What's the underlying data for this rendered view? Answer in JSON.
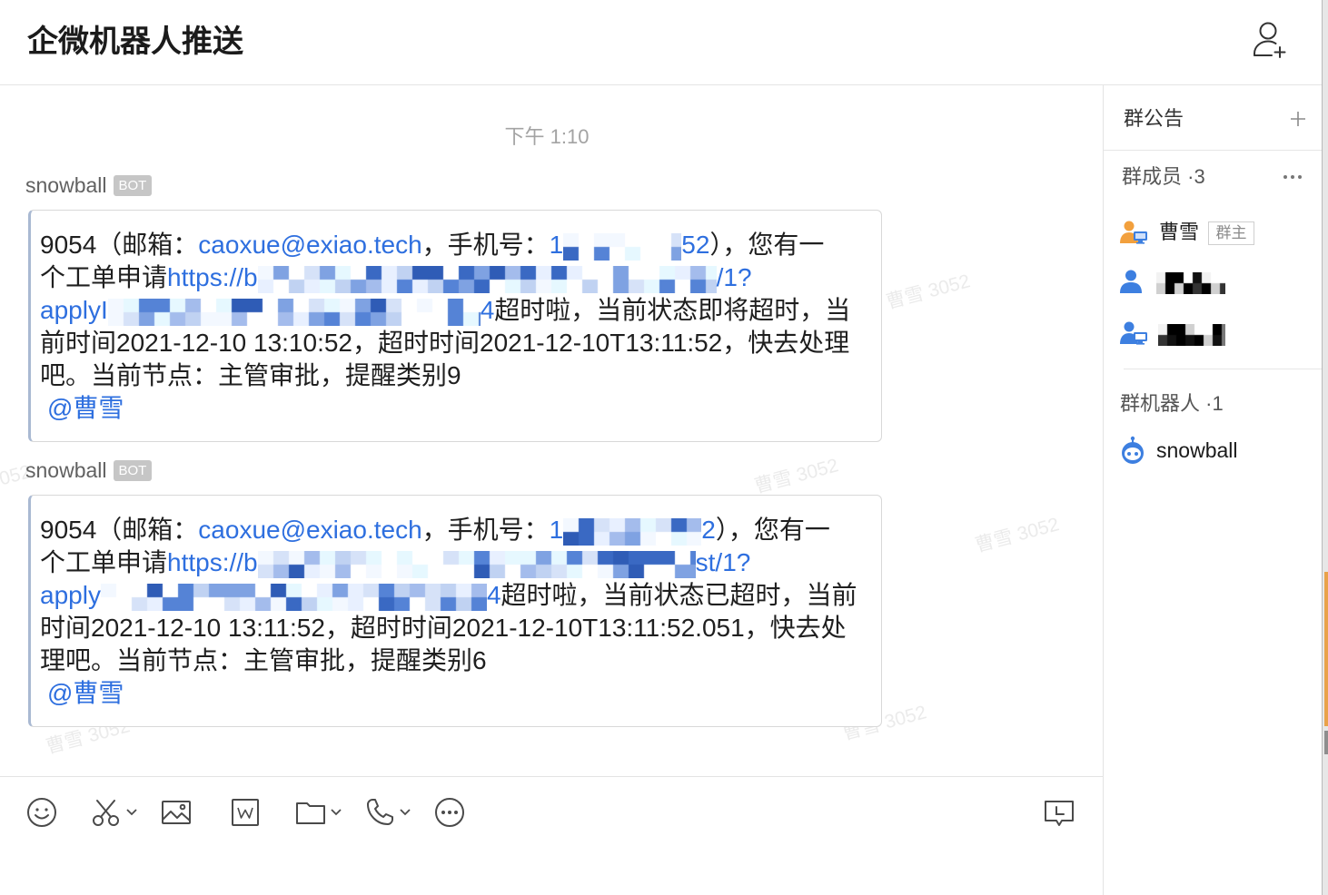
{
  "window": {
    "title": "企微机器人推送",
    "add_member_icon": "add-person-icon"
  },
  "chat": {
    "timestamp": "下午 1:10",
    "watermark": "曹雪 3052",
    "messages": [
      {
        "sender": "snowball",
        "badge": "BOT",
        "lines": [
          [
            {
              "t": "text",
              "v": "9054（邮箱："
            },
            {
              "t": "link",
              "v": "caoxue@exiao.tech"
            },
            {
              "t": "text",
              "v": "，手机号："
            },
            {
              "t": "link",
              "v": "1"
            },
            {
              "t": "redacted"
            },
            {
              "t": "link",
              "v": "52"
            },
            {
              "t": "text",
              "v": "），您有一"
            }
          ],
          [
            {
              "t": "text",
              "v": "个工单申请"
            },
            {
              "t": "link",
              "v": "https://b"
            },
            {
              "t": "redacted"
            },
            {
              "t": "link",
              "v": "/1?"
            }
          ],
          [
            {
              "t": "link",
              "v": "applyI"
            },
            {
              "t": "redacted"
            },
            {
              "t": "link",
              "v": "4"
            },
            {
              "t": "text",
              "v": "超时啦，当前状态即将超时，当"
            }
          ],
          [
            {
              "t": "text",
              "v": "前时间2021-12-10 13:10:52，超时时间2021-12-10T13:11:52，快去处理"
            }
          ],
          [
            {
              "t": "text",
              "v": "吧。当前节点：主管审批，提醒类别9"
            }
          ],
          [
            {
              "t": "mention",
              "v": "@曹雪"
            }
          ]
        ]
      },
      {
        "sender": "snowball",
        "badge": "BOT",
        "lines": [
          [
            {
              "t": "text",
              "v": "9054（邮箱："
            },
            {
              "t": "link",
              "v": "caoxue@exiao.tech"
            },
            {
              "t": "text",
              "v": "，手机号："
            },
            {
              "t": "link",
              "v": "1"
            },
            {
              "t": "redacted"
            },
            {
              "t": "link",
              "v": "2"
            },
            {
              "t": "text",
              "v": "），您有一"
            }
          ],
          [
            {
              "t": "text",
              "v": "个工单申请"
            },
            {
              "t": "link",
              "v": "https://b"
            },
            {
              "t": "redacted"
            },
            {
              "t": "link",
              "v": "st/1?"
            }
          ],
          [
            {
              "t": "link",
              "v": "apply"
            },
            {
              "t": "redacted"
            },
            {
              "t": "link",
              "v": "4"
            },
            {
              "t": "text",
              "v": "超时啦，当前状态已超时，当前"
            }
          ],
          [
            {
              "t": "text",
              "v": "时间2021-12-10 13:11:52，超时时间2021-12-10T13:11:52.051，快去处"
            }
          ],
          [
            {
              "t": "text",
              "v": "理吧。当前节点：主管审批，提醒类别6"
            }
          ],
          [
            {
              "t": "mention",
              "v": "@曹雪"
            }
          ]
        ]
      }
    ]
  },
  "toolbar": {
    "icons": [
      {
        "name": "emoji-icon"
      },
      {
        "name": "scissors-icon",
        "dropdown": true
      },
      {
        "name": "image-icon"
      },
      {
        "name": "word-doc-icon"
      },
      {
        "name": "folder-icon",
        "dropdown": true
      },
      {
        "name": "phone-icon",
        "dropdown": true
      },
      {
        "name": "more-icon"
      }
    ],
    "right_icon": "chat-history-icon"
  },
  "sidebar": {
    "announcement": {
      "label": "群公告",
      "add_icon": "plus-icon"
    },
    "members": {
      "label": "群成员 ·3",
      "more_icon": "more-dots-icon",
      "items": [
        {
          "name": "曹雪",
          "role": "群主",
          "avatar": "person-computer-icon"
        },
        {
          "redacted": true,
          "avatar": "person-icon"
        },
        {
          "redacted": true,
          "avatar": "person-computer-icon"
        }
      ]
    },
    "bots": {
      "label": "群机器人 ·1",
      "items": [
        {
          "name": "snowball",
          "icon": "robot-icon"
        }
      ]
    }
  },
  "colors": {
    "link": "#2e6fdf",
    "text": "#1f1f1f",
    "badge_bg": "#c6c6c6",
    "avatar_orange": "#f2a03d",
    "avatar_blue": "#3d7fe0"
  }
}
